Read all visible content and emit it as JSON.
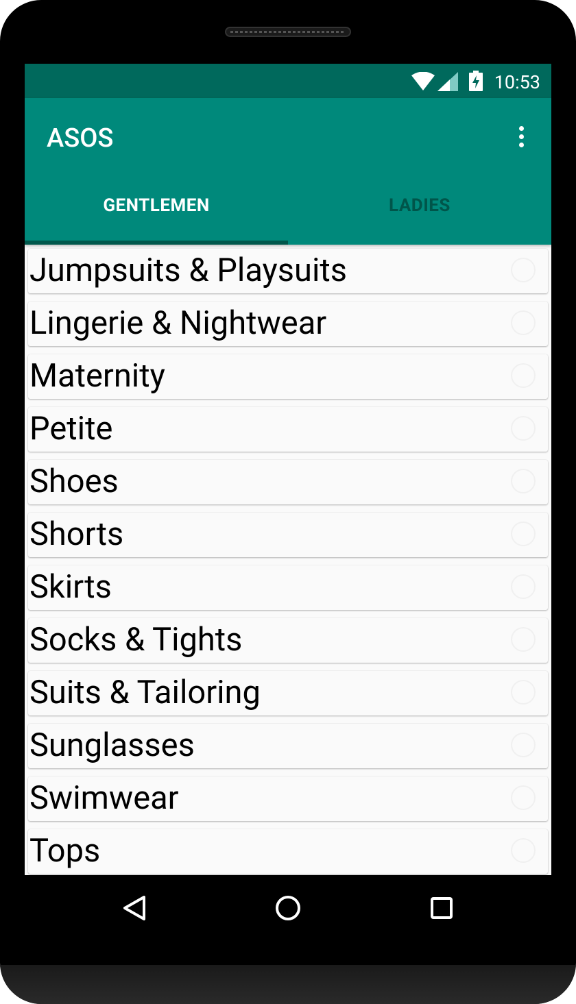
{
  "status_bar": {
    "time": "10:53",
    "icons": [
      "wifi-icon",
      "signal-icon",
      "battery-charging-icon"
    ]
  },
  "app_bar": {
    "title": "ASOS",
    "menu_icon": "overflow-menu-icon"
  },
  "tabs": [
    {
      "label": "GENTLEMEN",
      "selected": true
    },
    {
      "label": "LADIES",
      "selected": false
    }
  ],
  "categories": [
    "Jumpsuits & Playsuits",
    "Lingerie & Nightwear",
    "Maternity",
    "Petite",
    "Shoes",
    "Shorts",
    "Skirts",
    "Socks & Tights",
    "Suits & Tailoring",
    "Sunglasses",
    "Swimwear",
    "Tops"
  ],
  "nav_bar": {
    "buttons": [
      "back-icon",
      "home-icon",
      "recents-icon"
    ]
  },
  "colors": {
    "status_bar": "#00695c",
    "app_bar": "#00897b",
    "tab_indicator": "#00574b",
    "list_bg": "#fafafa"
  }
}
